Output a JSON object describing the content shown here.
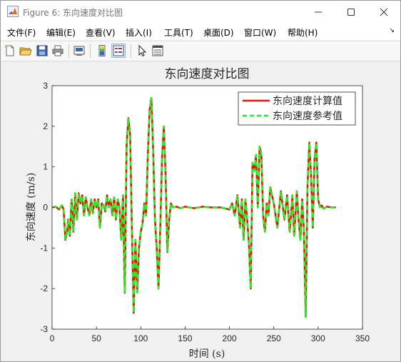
{
  "window": {
    "title": "Figure 6: 东向速度对比图",
    "controls": {
      "minimize": "minimize",
      "maximize": "maximize",
      "close": "close"
    }
  },
  "menu": {
    "items": [
      "文件(F)",
      "编辑(E)",
      "查看(V)",
      "插入(I)",
      "工具(T)",
      "桌面(D)",
      "窗口(W)",
      "帮助(H)"
    ],
    "overflow_arrow": "↘"
  },
  "toolbar": {
    "icons": [
      "new-figure-icon",
      "open-file-icon",
      "save-icon",
      "print-icon",
      "link-plot-icon",
      "colorbar-icon",
      "legend-icon",
      "pointer-icon",
      "property-editor-icon"
    ]
  },
  "colors": {
    "computed": "#ee1111",
    "reference": "#22ee22",
    "axes_text": "#262626"
  },
  "chart_data": {
    "type": "line",
    "title": "东向速度对比图",
    "xlabel": "时间 (s)",
    "ylabel": "东向速度 (m/s)",
    "xlim": [
      0,
      350
    ],
    "ylim": [
      -3,
      3
    ],
    "xticks": [
      "0",
      "50",
      "100",
      "150",
      "200",
      "250",
      "300",
      "350"
    ],
    "yticks": [
      "3",
      "2",
      "1",
      "0",
      "-1",
      "-2",
      "-3"
    ],
    "grid": false,
    "legend_position": "top-right",
    "series": [
      {
        "name": "东向速度计算值",
        "style": "solid",
        "color": "#ee1111",
        "x": [
          0,
          4,
          8,
          11,
          13,
          15,
          17,
          18,
          20,
          22,
          24,
          26,
          28,
          30,
          32,
          34,
          36,
          38,
          40,
          42,
          44,
          46,
          48,
          50,
          52,
          54,
          56,
          58,
          60,
          62,
          64,
          66,
          68,
          70,
          72,
          74,
          76,
          78,
          80,
          82,
          84,
          86,
          88,
          90,
          92,
          94,
          96,
          98,
          100,
          102,
          104,
          106,
          108,
          110,
          112,
          114,
          116,
          118,
          120,
          122,
          124,
          126,
          128,
          130,
          132,
          134,
          136,
          140,
          145,
          150,
          160,
          170,
          180,
          190,
          200,
          203,
          206,
          209,
          212,
          214,
          216,
          218,
          220,
          222,
          224,
          226,
          228,
          230,
          232,
          234,
          236,
          238,
          240,
          242,
          244,
          246,
          250,
          254,
          258,
          262,
          265,
          268,
          271,
          273,
          276,
          278,
          280,
          282,
          284,
          286,
          288,
          290,
          292,
          294,
          296,
          298,
          300,
          302,
          304,
          306,
          310,
          315,
          320
        ],
        "y": [
          0,
          0.02,
          -0.05,
          0.05,
          -0.05,
          -0.8,
          -0.6,
          -0.3,
          -0.7,
          0.2,
          -0.6,
          0.35,
          -0.3,
          0.35,
          0.1,
          0.3,
          -0.2,
          0.25,
          0,
          -0.2,
          0.2,
          -0.15,
          0.2,
          0,
          0.2,
          -0.5,
          0.1,
          0.05,
          -0.1,
          0.3,
          0,
          0.2,
          -0.2,
          0.25,
          -0.3,
          0.2,
          0,
          -0.8,
          0.3,
          -2.1,
          1.5,
          2.2,
          1.8,
          -0.5,
          -2.6,
          -0.8,
          -2.1,
          -1.0,
          -0.6,
          -0.4,
          0.1,
          -0.2,
          1.3,
          2.4,
          2.7,
          1.4,
          -0.3,
          -1.0,
          -2.0,
          -0.5,
          1.2,
          2.0,
          0.8,
          -1.1,
          -0.3,
          0.1,
          0,
          0.02,
          -0.02,
          0.02,
          -0.02,
          0.02,
          0,
          0,
          -0.05,
          0.1,
          -0.2,
          0.3,
          -0.5,
          0.2,
          -0.8,
          0.2,
          -0.3,
          -0.9,
          -2.0,
          1.1,
          0.9,
          1.3,
          0,
          1.5,
          1.3,
          -0.2,
          -0.6,
          0.1,
          -0.2,
          0.5,
          0.1,
          -0.5,
          0.4,
          -0.3,
          0.3,
          -0.6,
          0.3,
          -0.7,
          0.4,
          -0.3,
          -0.8,
          0.2,
          -0.6,
          -2.7,
          0.5,
          1.6,
          0.8,
          -0.5,
          1.2,
          1.6,
          0.2,
          0,
          0.05,
          -0.03,
          0.02,
          0,
          0
        ]
      },
      {
        "name": "东向速度参考值",
        "style": "dashed",
        "color": "#22ee22",
        "x": [
          0,
          4,
          8,
          11,
          13,
          15,
          17,
          18,
          20,
          22,
          24,
          26,
          28,
          30,
          32,
          34,
          36,
          38,
          40,
          42,
          44,
          46,
          48,
          50,
          52,
          54,
          56,
          58,
          60,
          62,
          64,
          66,
          68,
          70,
          72,
          74,
          76,
          78,
          80,
          82,
          84,
          86,
          88,
          90,
          92,
          94,
          96,
          98,
          100,
          102,
          104,
          106,
          108,
          110,
          112,
          114,
          116,
          118,
          120,
          122,
          124,
          126,
          128,
          130,
          132,
          134,
          136,
          140,
          145,
          150,
          160,
          170,
          180,
          190,
          200,
          203,
          206,
          209,
          212,
          214,
          216,
          218,
          220,
          222,
          224,
          226,
          228,
          230,
          232,
          234,
          236,
          238,
          240,
          242,
          244,
          246,
          250,
          254,
          258,
          262,
          265,
          268,
          271,
          273,
          276,
          278,
          280,
          282,
          284,
          286,
          288,
          290,
          292,
          294,
          296,
          298,
          300,
          302,
          304,
          306,
          310,
          315,
          320
        ],
        "y": [
          0,
          0.02,
          -0.05,
          0.05,
          -0.05,
          -0.8,
          -0.6,
          -0.3,
          -0.7,
          0.2,
          -0.6,
          0.35,
          -0.3,
          0.35,
          0.1,
          0.3,
          -0.2,
          0.25,
          0,
          -0.2,
          0.2,
          -0.15,
          0.2,
          0,
          0.2,
          -0.5,
          0.1,
          0.05,
          -0.1,
          0.3,
          0,
          0.2,
          -0.2,
          0.25,
          -0.3,
          0.2,
          0,
          -0.8,
          0.3,
          -2.1,
          1.5,
          2.2,
          1.8,
          -0.5,
          -2.6,
          -0.8,
          -2.1,
          -1.0,
          -0.6,
          -0.4,
          0.1,
          -0.2,
          1.3,
          2.4,
          2.7,
          1.4,
          -0.3,
          -1.0,
          -2.0,
          -0.5,
          1.2,
          2.0,
          0.8,
          -1.1,
          -0.3,
          0.1,
          0,
          0.02,
          -0.02,
          0.02,
          -0.02,
          0.02,
          0,
          0,
          -0.05,
          0.1,
          -0.2,
          0.3,
          -0.5,
          0.2,
          -0.8,
          0.2,
          -0.3,
          -0.9,
          -2.0,
          1.1,
          0.9,
          1.3,
          0,
          1.5,
          1.3,
          -0.2,
          -0.6,
          0.1,
          -0.2,
          0.5,
          0.1,
          -0.5,
          0.4,
          -0.3,
          0.3,
          -0.6,
          0.3,
          -0.7,
          0.4,
          -0.3,
          -0.8,
          0.2,
          -0.6,
          -2.7,
          0.5,
          1.6,
          0.8,
          -0.5,
          1.2,
          1.6,
          0.2,
          0,
          0.05,
          -0.03,
          0.02,
          0,
          0
        ]
      }
    ]
  }
}
